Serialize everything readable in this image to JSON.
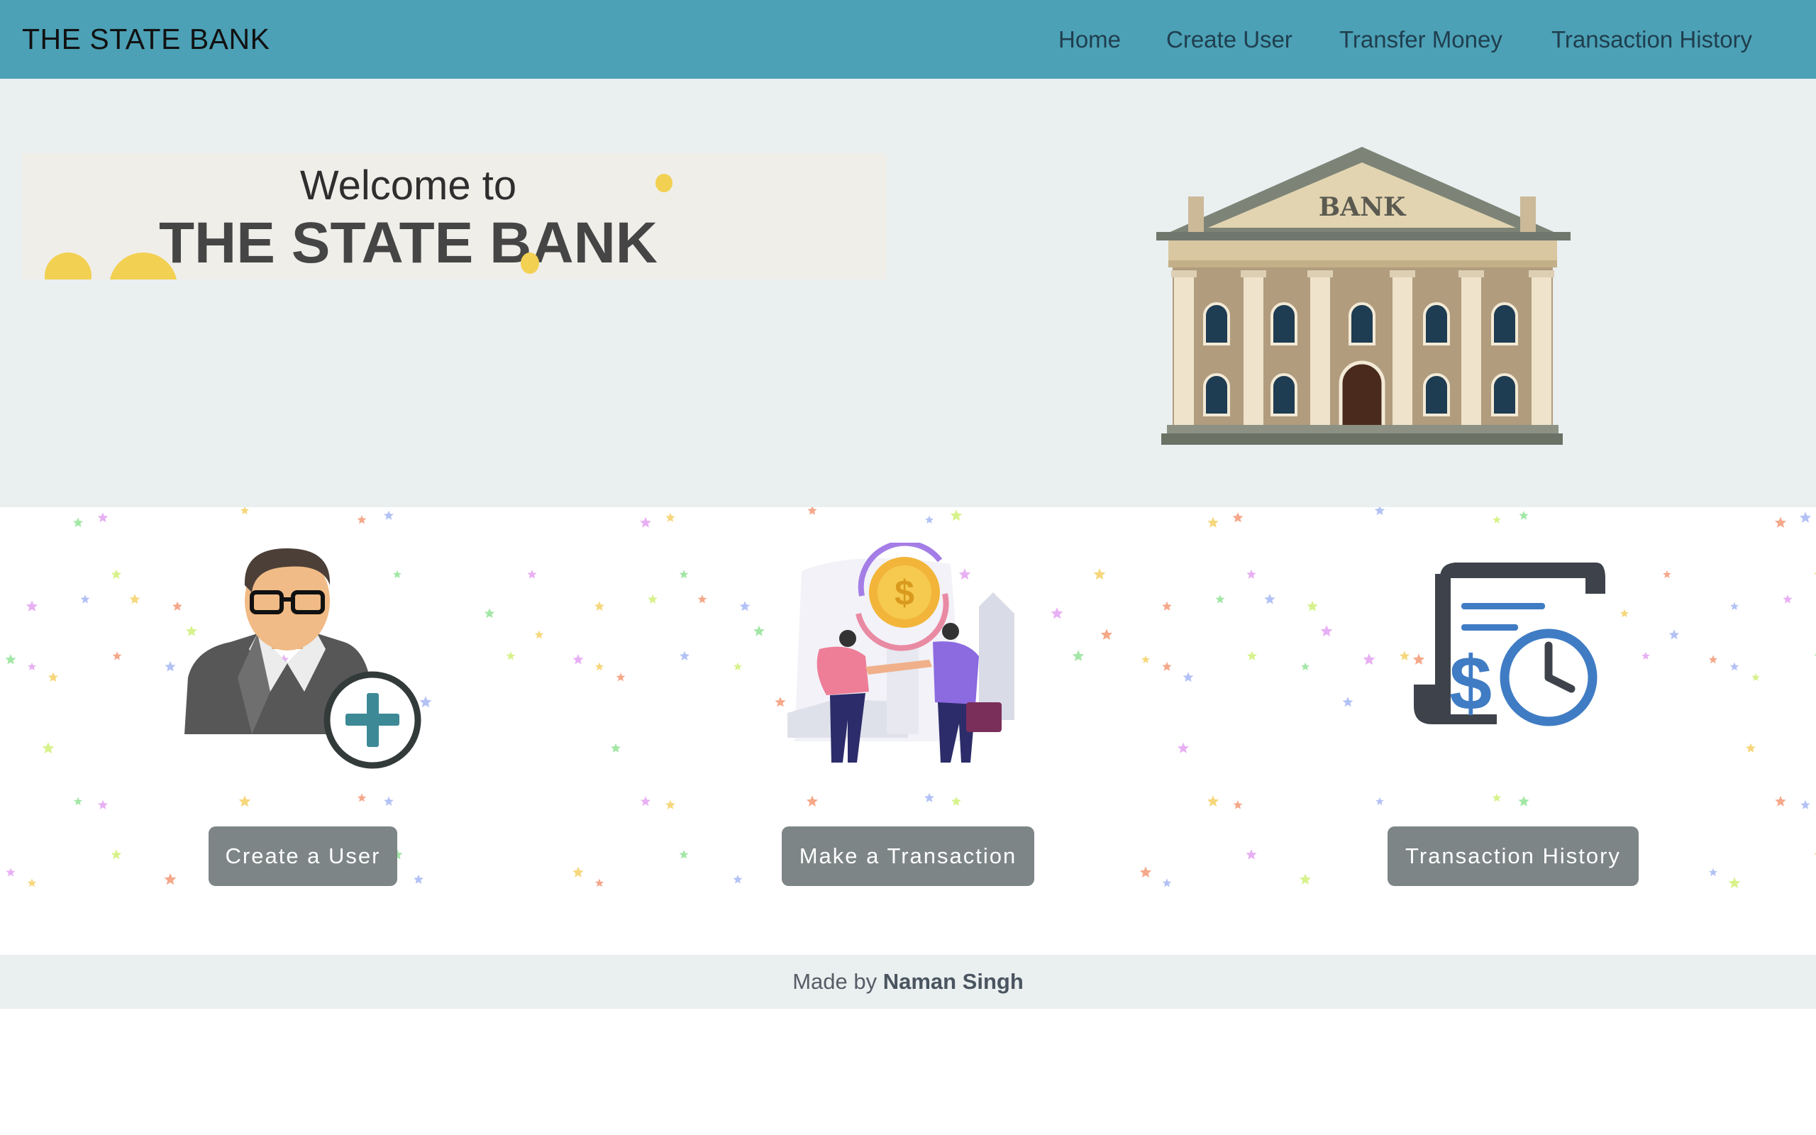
{
  "navbar": {
    "brand": "THE STATE BANK",
    "links": [
      "Home",
      "Create User",
      "Transfer Money",
      "Transaction History"
    ]
  },
  "hero": {
    "welcome": "Welcome to",
    "bank_name": "THE STATE BANK",
    "building_sign": "BANK"
  },
  "features": {
    "cards": [
      {
        "button": "Create a User",
        "icon": "add-user-icon"
      },
      {
        "button": "Make a Transaction",
        "icon": "handshake-transaction-icon"
      },
      {
        "button": "Transaction History",
        "icon": "transaction-history-icon"
      }
    ]
  },
  "footer": {
    "made_by": "Made by",
    "author": "Naman Singh"
  },
  "colors": {
    "navbar": "#4ca1b6",
    "hero_bg": "#eaeff0",
    "button_bg": "#7d8586",
    "accent_yellow": "#f2d052"
  }
}
